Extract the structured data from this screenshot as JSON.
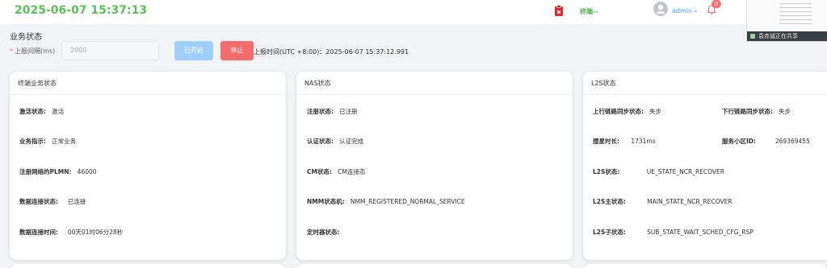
{
  "header": {
    "datetime": "2025-06-07 15:37:13",
    "terminal_link": "终端--",
    "username": "admin",
    "notification_count": "0"
  },
  "screen_share": {
    "label": "袁赤诚正在共享"
  },
  "business": {
    "title": "业务状态",
    "interval_label": "上报间隔(ms)",
    "interval_required": "*",
    "interval_value": "2000",
    "started_button": "已开启",
    "stop_button": "停止",
    "report_time": "上报时间(UTC +8:00)：2025-06-07 15:37:12.991"
  },
  "terminal_card": {
    "title": "终端业务状态",
    "fields": [
      {
        "label": "激活状态:",
        "value": "激活"
      },
      {
        "label": "业务指示:",
        "value": "正常业务"
      },
      {
        "label": "注册网络的PLMN:",
        "value": "46000"
      },
      {
        "label": "数据连接状态:",
        "value": "已连接"
      },
      {
        "label": "数据连接时间:",
        "value": "00天01时06分28秒"
      }
    ]
  },
  "nas_card": {
    "title": "NAS状态",
    "fields": [
      {
        "label": "注册状态:",
        "value": "已注册"
      },
      {
        "label": "认证状态:",
        "value": "认证完成"
      },
      {
        "label": "CM状态:",
        "value": "CM连接态"
      },
      {
        "label": "NMM状态机:",
        "value": "NMM_REGISTERED_NORMAL_SERVICE"
      },
      {
        "label": "定时器状态:",
        "value": ""
      }
    ]
  },
  "l2s_card": {
    "title": "L2S状态",
    "uplink_sync": {
      "label": "上行链路同步状态:",
      "value": "失步"
    },
    "downlink_sync": {
      "label": "下行链路同步状态:",
      "value": "失步"
    },
    "star_search": {
      "label": "搜星时长:",
      "value": "1731ms"
    },
    "cell_id": {
      "label": "服务小区ID:",
      "value": "269369455"
    },
    "l2s_state": {
      "label": "L2S状态:",
      "value": "UE_STATE_NCR_RECOVER"
    },
    "l2s_main": {
      "label": "L2S主状态:",
      "value": "MAIN_STATE_NCR_RECOVER"
    },
    "l2s_sub": {
      "label": "L2S子状态:",
      "value": "SUB_STATE_WAIT_SCHED_CFG_RSP"
    }
  },
  "colors": {
    "clock": "#57c255",
    "accent": "#409eff",
    "danger": "#f56c6c",
    "disabled_primary": "#a0cfff"
  },
  "icons": [
    "clipboard-x-icon",
    "avatar-icon",
    "chevron-down-icon",
    "bell-icon",
    "screen-share-icon"
  ]
}
